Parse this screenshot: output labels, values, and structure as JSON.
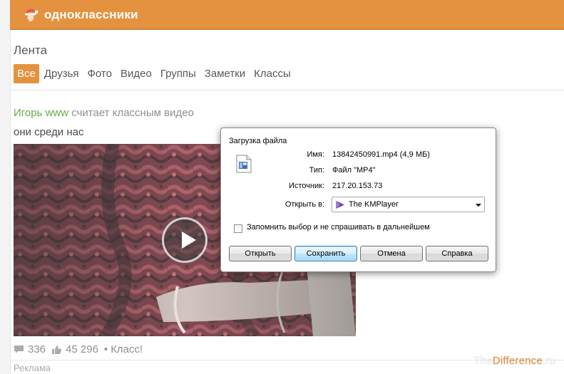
{
  "site": {
    "brand": "одноклассники",
    "logo_icon": "ok-santa-icon",
    "accent_color": "#e07b16"
  },
  "feed": {
    "title": "Лента",
    "tabs": [
      "Все",
      "Друзья",
      "Фото",
      "Видео",
      "Группы",
      "Заметки",
      "Классы"
    ],
    "active_tab": "Все"
  },
  "post": {
    "author": "Игорь www",
    "action": "считает классным видео",
    "text": "они среди нас",
    "comments": "336",
    "likes": "45 296",
    "separator": "•",
    "klass": "Класс!"
  },
  "ad_label": "Реклама",
  "watermark": {
    "part1": "The",
    "part2": "Difference",
    "part3": ".ru"
  },
  "dialog": {
    "title": "Загрузка файла",
    "name_label": "Имя:",
    "name_value": "13842450991.mp4 (4,9 МБ)",
    "type_label": "Тип:",
    "type_value": "Файл \"MP4\"",
    "source_label": "Источник:",
    "source_value": "217.20.153.73",
    "open_with_label": "Открыть в:",
    "open_with_value": "The KMPlayer",
    "remember_label": "Запомнить выбор и не спрашивать в дальнейшем",
    "remember_checked": false,
    "buttons": {
      "open": "Открыть",
      "save": "Сохранить",
      "cancel": "Отмена",
      "help": "Справка"
    }
  }
}
